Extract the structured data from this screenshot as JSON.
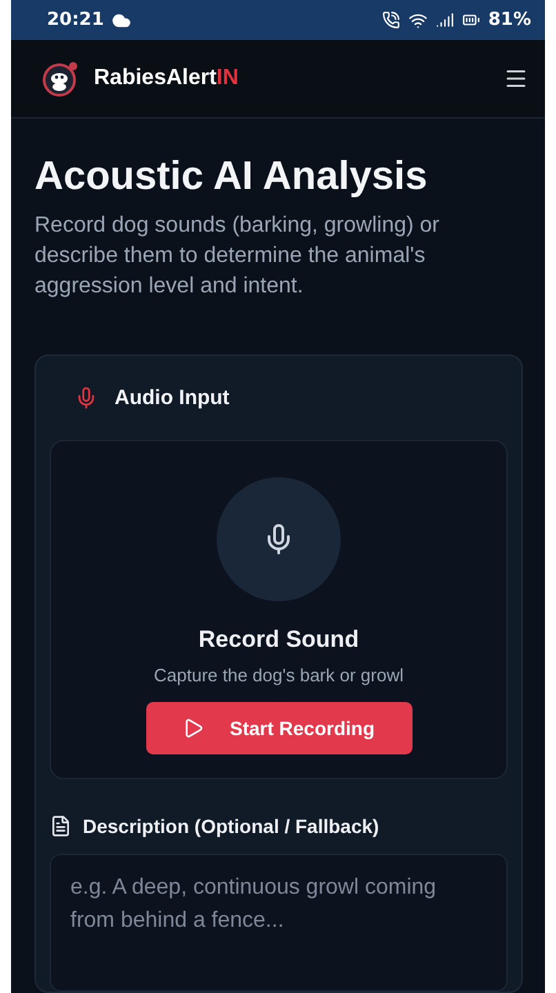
{
  "status_bar": {
    "time": "20:21",
    "battery": "81%"
  },
  "header": {
    "brand_name": "RabiesAlert",
    "brand_suffix": "IN"
  },
  "page": {
    "title": "Acoustic AI Analysis",
    "subtitle": "Record dog sounds (barking, growling) or describe them to determine the animal's aggression level and intent."
  },
  "audio_card": {
    "title": "Audio Input",
    "record_title": "Record Sound",
    "record_hint": "Capture the dog's bark or growl",
    "record_button": "Start Recording"
  },
  "description": {
    "label": "Description (Optional / Fallback)",
    "placeholder": "e.g. A deep, continuous growl coming from behind a fence..."
  }
}
